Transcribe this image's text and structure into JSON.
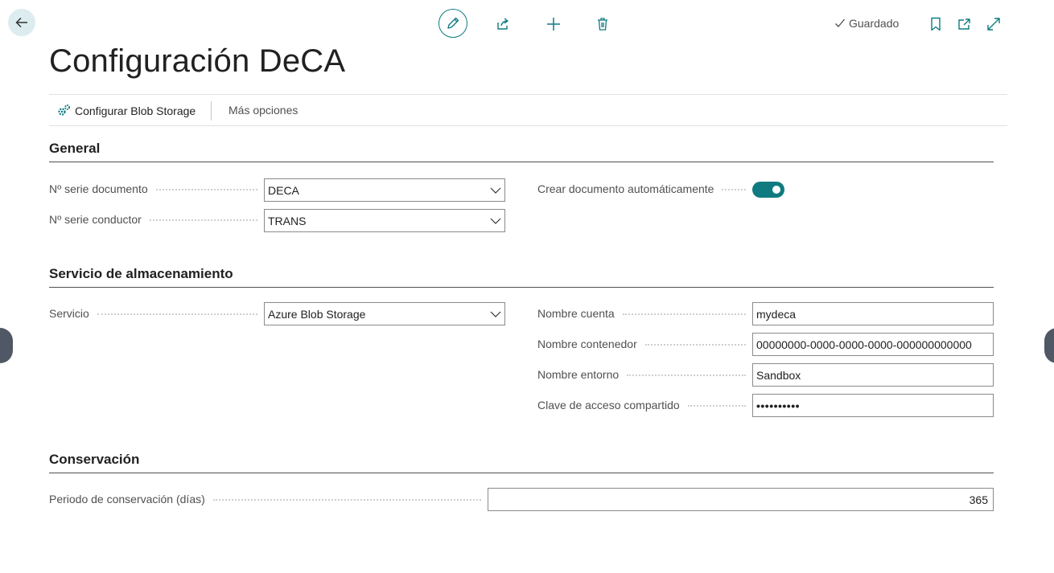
{
  "header": {
    "saved_label": "Guardado",
    "title": "Configuración DeCA"
  },
  "toolbar": {
    "icons": [
      "back-arrow-icon",
      "edit-pencil-icon",
      "share-icon",
      "add-plus-icon",
      "delete-trash-icon",
      "checkmark-icon",
      "bookmark-icon",
      "open-in-new-window-icon",
      "expand-icon"
    ]
  },
  "actions": {
    "configure_blob": "Configurar Blob Storage",
    "more_options": "Más opciones"
  },
  "general": {
    "title": "General",
    "doc_series_label": "Nº serie documento",
    "doc_series_value": "DECA",
    "driver_series_label": "Nº serie conductor",
    "driver_series_value": "TRANS",
    "auto_create_label": "Crear documento automáticamente",
    "auto_create_on": true
  },
  "storage": {
    "title": "Servicio de almacenamiento",
    "service_label": "Servicio",
    "service_value": "Azure Blob Storage",
    "account_label": "Nombre cuenta",
    "account_value": "mydeca",
    "container_label": "Nombre contenedor",
    "container_value": "00000000-0000-0000-0000-000000000000",
    "environment_label": "Nombre entorno",
    "environment_value": "Sandbox",
    "shared_key_label": "Clave de acceso compartido",
    "shared_key_value": "••••••••••"
  },
  "retention": {
    "title": "Conservación",
    "period_label": "Periodo de conservación (días)",
    "period_value": "365"
  },
  "colors": {
    "accent": "#0f7b80",
    "back_button_bg": "#dcecef"
  }
}
